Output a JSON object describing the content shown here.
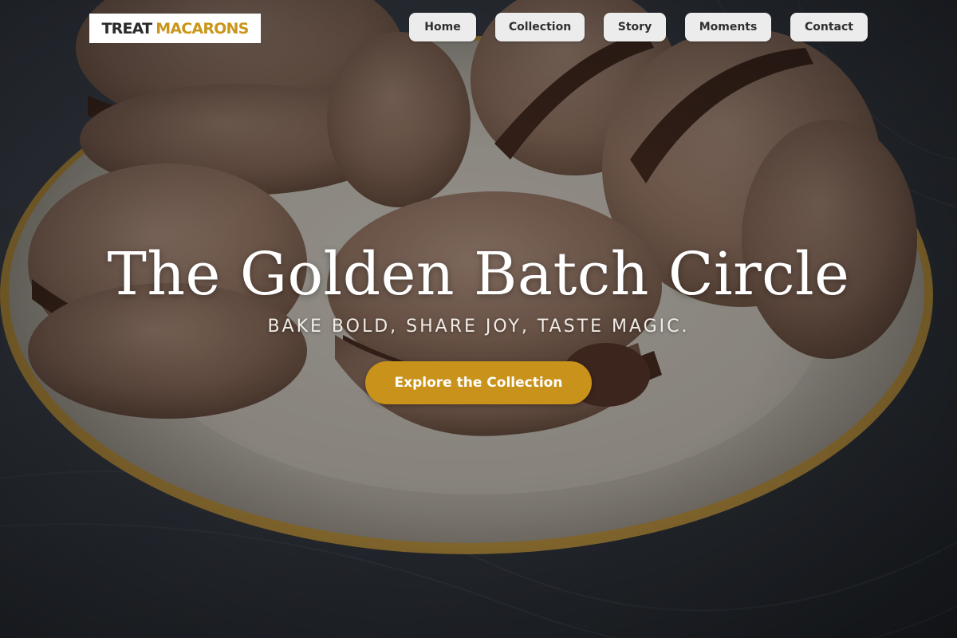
{
  "brand": {
    "word1": "TREAT",
    "word2": "MACARONS",
    "accent_color": "#c9961a"
  },
  "nav": {
    "items": [
      {
        "label": "Home"
      },
      {
        "label": "Collection"
      },
      {
        "label": "Story"
      },
      {
        "label": "Moments"
      },
      {
        "label": "Contact"
      }
    ]
  },
  "hero": {
    "title": "The Golden Batch Circle",
    "tagline": "BAKE BOLD, SHARE JOY, TASTE MAGIC.",
    "cta_label": "Explore the Collection",
    "cta_color": "#c8921b",
    "background": "chocolate macarons on a gold-rimmed plate over dark linen"
  }
}
